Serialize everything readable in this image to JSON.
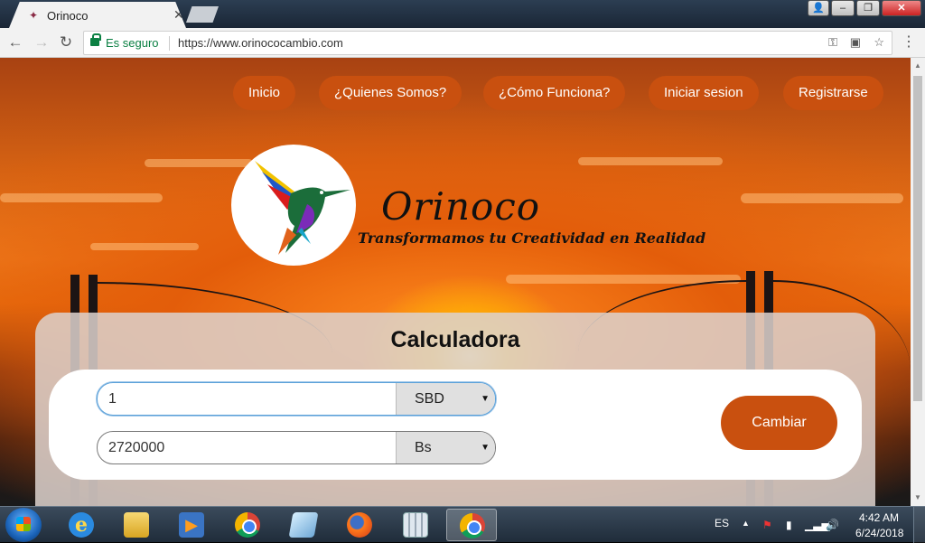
{
  "browser": {
    "tab_title": "Orinoco",
    "tab_icon": "hummingbird-favicon",
    "secure_label": "Es seguro",
    "url": "https://www.orinococambio.com"
  },
  "site": {
    "nav": [
      "Inicio",
      "¿Quienes Somos?",
      "¿Cómo Funciona?",
      "Iniciar sesion",
      "Registrarse"
    ],
    "brand": "Orinoco",
    "tagline": "Transformamos tu Creatividad en Realidad",
    "accent_color": "#c9500f"
  },
  "calculator": {
    "title": "Calculadora",
    "from_value": "1",
    "from_currency": "SBD",
    "to_value": "2720000",
    "to_currency": "Bs",
    "submit_label": "Cambiar"
  },
  "taskbar": {
    "language": "ES",
    "time": "4:42 AM",
    "date": "6/24/2018"
  }
}
